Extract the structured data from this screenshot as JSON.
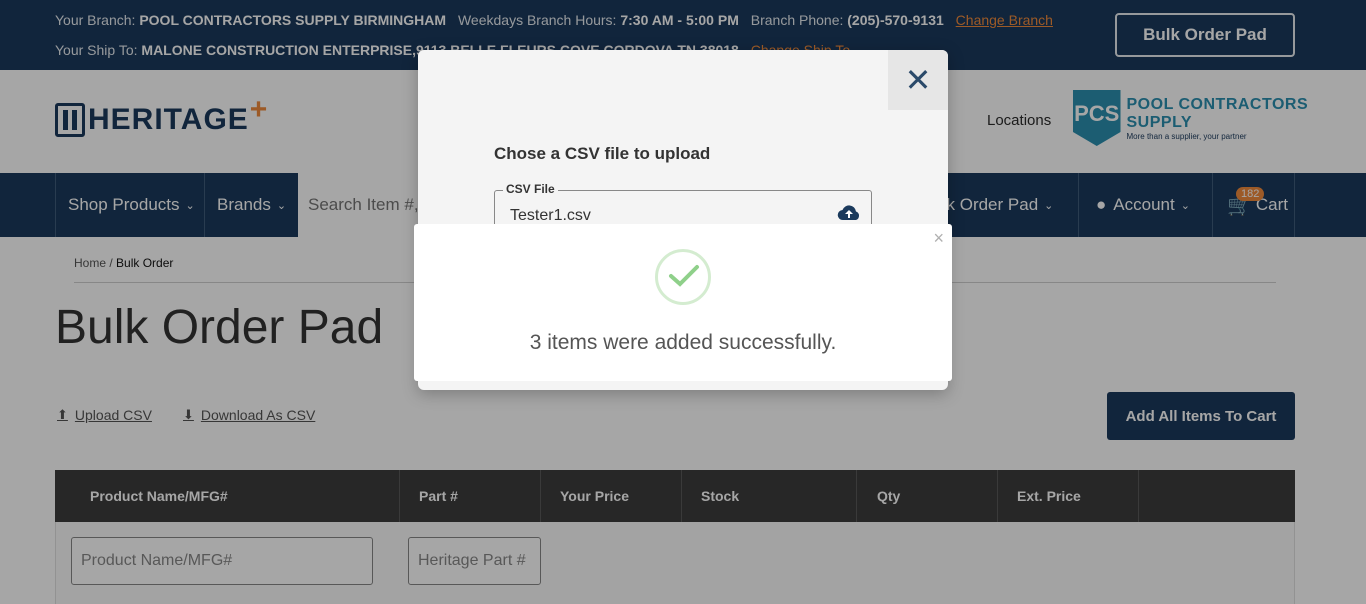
{
  "topbar": {
    "branch_label": "Your Branch:",
    "branch_value": "POOL CONTRACTORS SUPPLY BIRMINGHAM",
    "hours_label": "Weekdays Branch Hours:",
    "hours_value": "7:30 AM - 5:00 PM",
    "phone_label": "Branch Phone:",
    "phone_value": "(205)-570-9131",
    "change_branch": "Change Branch",
    "shipto_label": "Your Ship To:",
    "shipto_value": "MALONE CONSTRUCTION ENTERPRISE,9113 BELLE FLEURS COVE CORDOVA TN 38018",
    "change_shipto": "Change Ship To",
    "bulk_order_pad_button": "Bulk Order Pad"
  },
  "header": {
    "logo_text": "HERITAGE",
    "locations": "Locations",
    "pcs_logo": {
      "abbr": "PCS",
      "name": "POOL CONTRACTORS SUPPLY",
      "tagline": "More than a supplier, your partner"
    }
  },
  "nav": {
    "shop_products": "Shop Products",
    "brands": "Brands",
    "search_placeholder": "Search Item #, ...",
    "quick_order_pad": "ck Order Pad",
    "account": "Account",
    "cart": "Cart",
    "cart_count": "182"
  },
  "breadcrumb": {
    "home": "Home",
    "separator": "/",
    "current": "Bulk Order"
  },
  "page": {
    "title": "Bulk Order Pad",
    "upload_csv": "Upload CSV",
    "download_csv": "Download As CSV",
    "add_all_button": "Add All Items To Cart"
  },
  "table": {
    "headers": [
      "Product Name/MFG#",
      "Part #",
      "Your Price",
      "Stock",
      "Qty",
      "Ext. Price",
      ""
    ],
    "row_inputs": {
      "product_placeholder": "Product Name/MFG#",
      "part_placeholder": "Heritage Part #"
    }
  },
  "upload_dialog": {
    "title": "Chose a CSV file to upload",
    "field_label": "CSV File",
    "file_name": "Tester1.csv"
  },
  "success_dialog": {
    "message": "3 items were added successfully."
  },
  "colors": {
    "navy": "#1b3a5c",
    "orange": "#f08a3c",
    "success": "#8fd08a"
  }
}
